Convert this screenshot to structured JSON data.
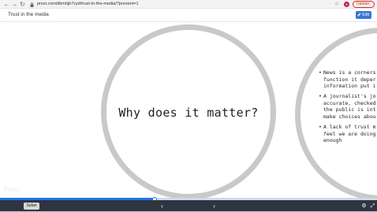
{
  "browser": {
    "url": "prezi.com/dkmhjb7vyd/trust-in-the-media/?present=1",
    "avatar_letter": "S",
    "update_label": "Update",
    "update_menu_glyph": "⋮",
    "back_glyph": "←",
    "forward_glyph": "→",
    "reload_glyph": "↻",
    "star_glyph": "☆"
  },
  "presentation": {
    "title": "Trust in the media",
    "edit_label": "Edit",
    "watermark": "Prezi"
  },
  "slide": {
    "heading": "Why does it matter?",
    "bullets": [
      [
        "News is a corners",
        "function it deper",
        "information put i"
      ],
      [
        "A journalist's jo",
        "accurate, checked",
        "the public is int",
        "make choices abou"
      ],
      [
        "A lack of trust m",
        "feel we are doing",
        "enough"
      ]
    ]
  },
  "playback": {
    "progress_percent": 41,
    "tab_tooltip": "Safari",
    "prev_glyph": "‹",
    "next_glyph": "›",
    "settings_glyph": "⚙",
    "fullscreen_glyph": "⤢"
  }
}
